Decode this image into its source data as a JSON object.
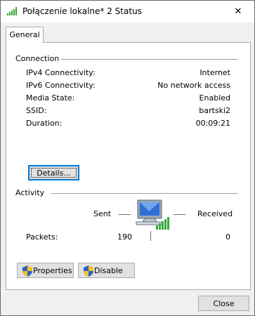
{
  "window": {
    "title": "Połączenie lokalne* 2 Status",
    "close_glyph": "✕"
  },
  "tabs": [
    {
      "label": "General",
      "selected": true
    }
  ],
  "connection": {
    "heading": "Connection",
    "rows": [
      {
        "label": "IPv4 Connectivity:",
        "value": "Internet"
      },
      {
        "label": "IPv6 Connectivity:",
        "value": "No network access"
      },
      {
        "label": "Media State:",
        "value": "Enabled"
      },
      {
        "label": "SSID:",
        "value": "bartski2"
      },
      {
        "label": "Duration:",
        "value": "00:09:21"
      }
    ],
    "details_label": "Details..."
  },
  "activity": {
    "heading": "Activity",
    "sent_label": "Sent",
    "received_label": "Received",
    "packets_label": "Packets:",
    "packets_sent": "190",
    "packets_received": "0",
    "icon": "wireless-network-computer-icon"
  },
  "buttons": {
    "properties_label": "Properties",
    "disable_label": "Disable",
    "close_label": "Close"
  },
  "icons": {
    "title": "wifi-signal-icon",
    "shield": "uac-shield-icon"
  },
  "colors": {
    "signal_green": "#3aa83a",
    "accent_blue": "#0078d7"
  }
}
